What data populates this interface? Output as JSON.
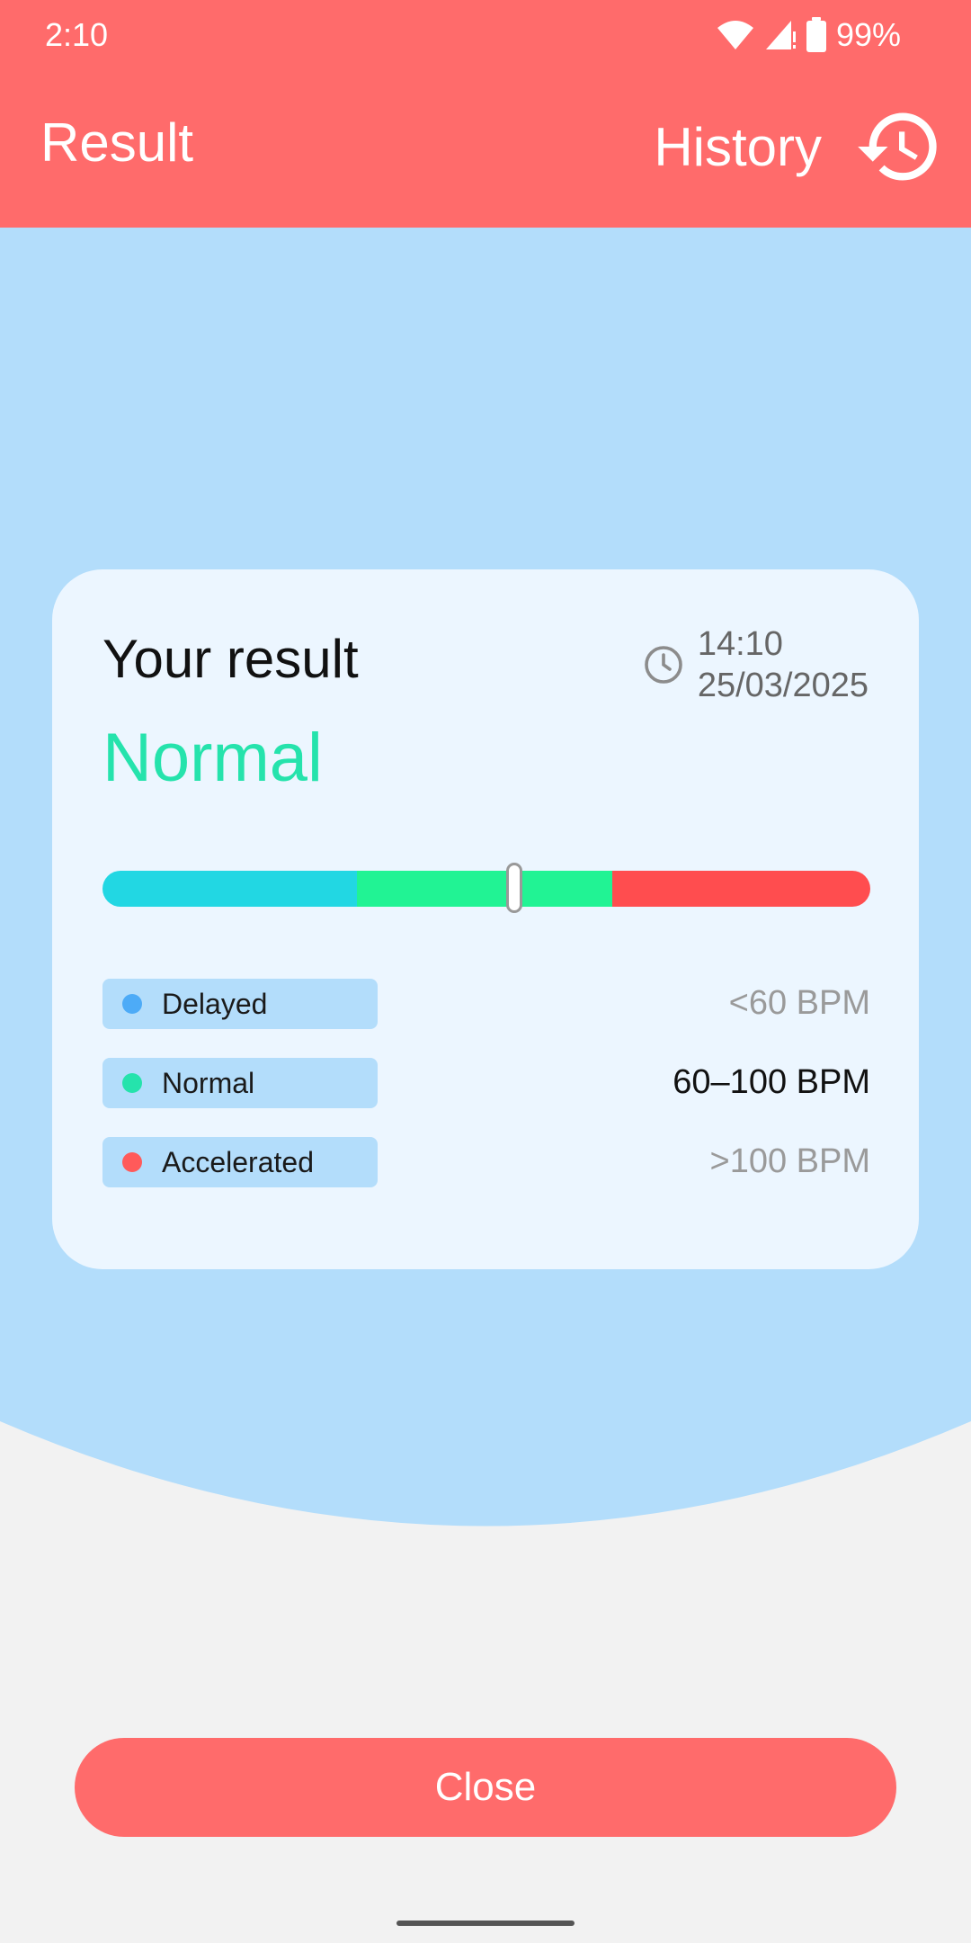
{
  "status_bar": {
    "time": "2:10",
    "battery": "99%",
    "icons": [
      "wifi-icon",
      "signal-icon",
      "battery-icon"
    ]
  },
  "app_bar": {
    "title": "Result",
    "history_label": "History",
    "history_icon": "history-icon",
    "background": "#ff6b6b"
  },
  "card": {
    "title": "Your result",
    "time": "14:10",
    "date": "25/03/2025",
    "clock_icon": "clock-icon",
    "status": "Normal",
    "status_color": "#25e3ac",
    "scale": {
      "segments": [
        {
          "name": "Delayed",
          "color": "#22d7e3"
        },
        {
          "name": "Normal",
          "color": "#21f394"
        },
        {
          "name": "Accelerated",
          "color": "#ff4d4f"
        }
      ],
      "indicator_fraction": 0.536
    },
    "legend": [
      {
        "label": "Delayed",
        "range": "<60 BPM",
        "dot_color": "#4dabf7",
        "active": false
      },
      {
        "label": "Normal",
        "range": "60–100 BPM",
        "dot_color": "#25e3ac",
        "active": true
      },
      {
        "label": "Accelerated",
        "range": ">100 BPM",
        "dot_color": "#ff5a5a",
        "active": false
      }
    ]
  },
  "actions": {
    "close_label": "Close"
  },
  "colors": {
    "accent": "#ff6b6b",
    "panel_blue": "#b3ddfb",
    "card_bg": "#ecf6ff",
    "page_bg": "#f2f2f2"
  }
}
